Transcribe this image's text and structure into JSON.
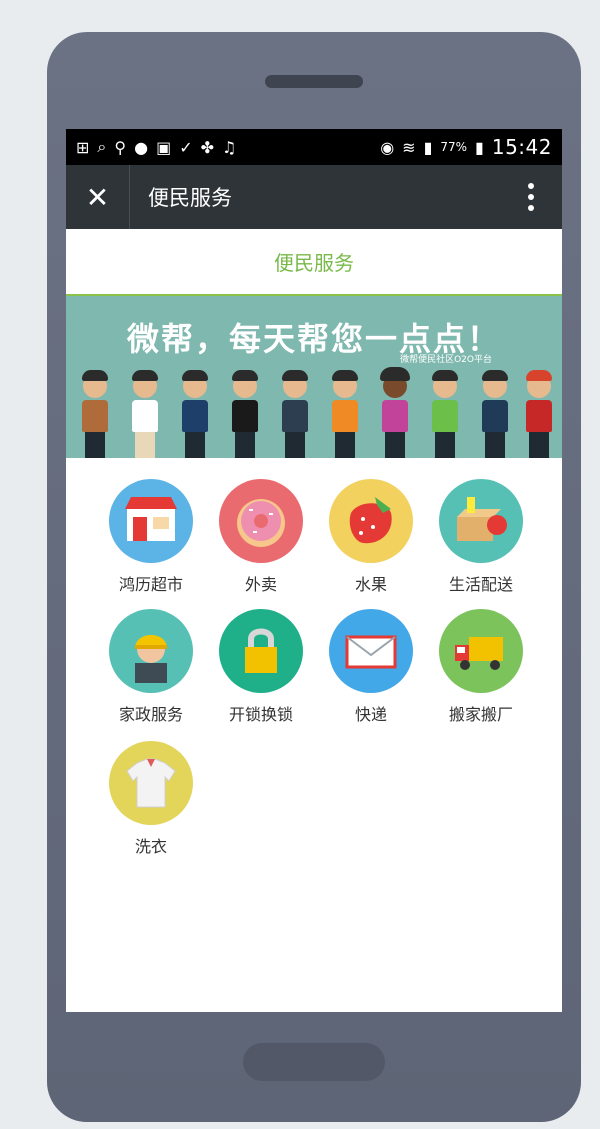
{
  "statusbar": {
    "battery": "77%",
    "time": "15:42"
  },
  "titlebar": {
    "title": "便民服务"
  },
  "page": {
    "heading": "便民服务"
  },
  "banner": {
    "slogan": "微帮，每天帮您一点点！",
    "subtitle": "微帮便民社区O2O平台"
  },
  "services": [
    {
      "label": "鸿历超市",
      "icon": "storefront-icon",
      "color": "#5bb3e6"
    },
    {
      "label": "外卖",
      "icon": "donut-icon",
      "color": "#ea6b6f"
    },
    {
      "label": "水果",
      "icon": "strawberry-icon",
      "color": "#f2d15f"
    },
    {
      "label": "生活配送",
      "icon": "delivery-box-icon",
      "color": "#56c0b4"
    },
    {
      "label": "家政服务",
      "icon": "worker-icon",
      "color": "#56c0b4"
    },
    {
      "label": "开锁换锁",
      "icon": "padlock-icon",
      "color": "#1fb08a"
    },
    {
      "label": "快递",
      "icon": "envelope-icon",
      "color": "#43a8e8"
    },
    {
      "label": "搬家搬厂",
      "icon": "truck-icon",
      "color": "#7cc35c"
    },
    {
      "label": "洗衣",
      "icon": "shirt-icon",
      "color": "#e3d45a"
    }
  ]
}
